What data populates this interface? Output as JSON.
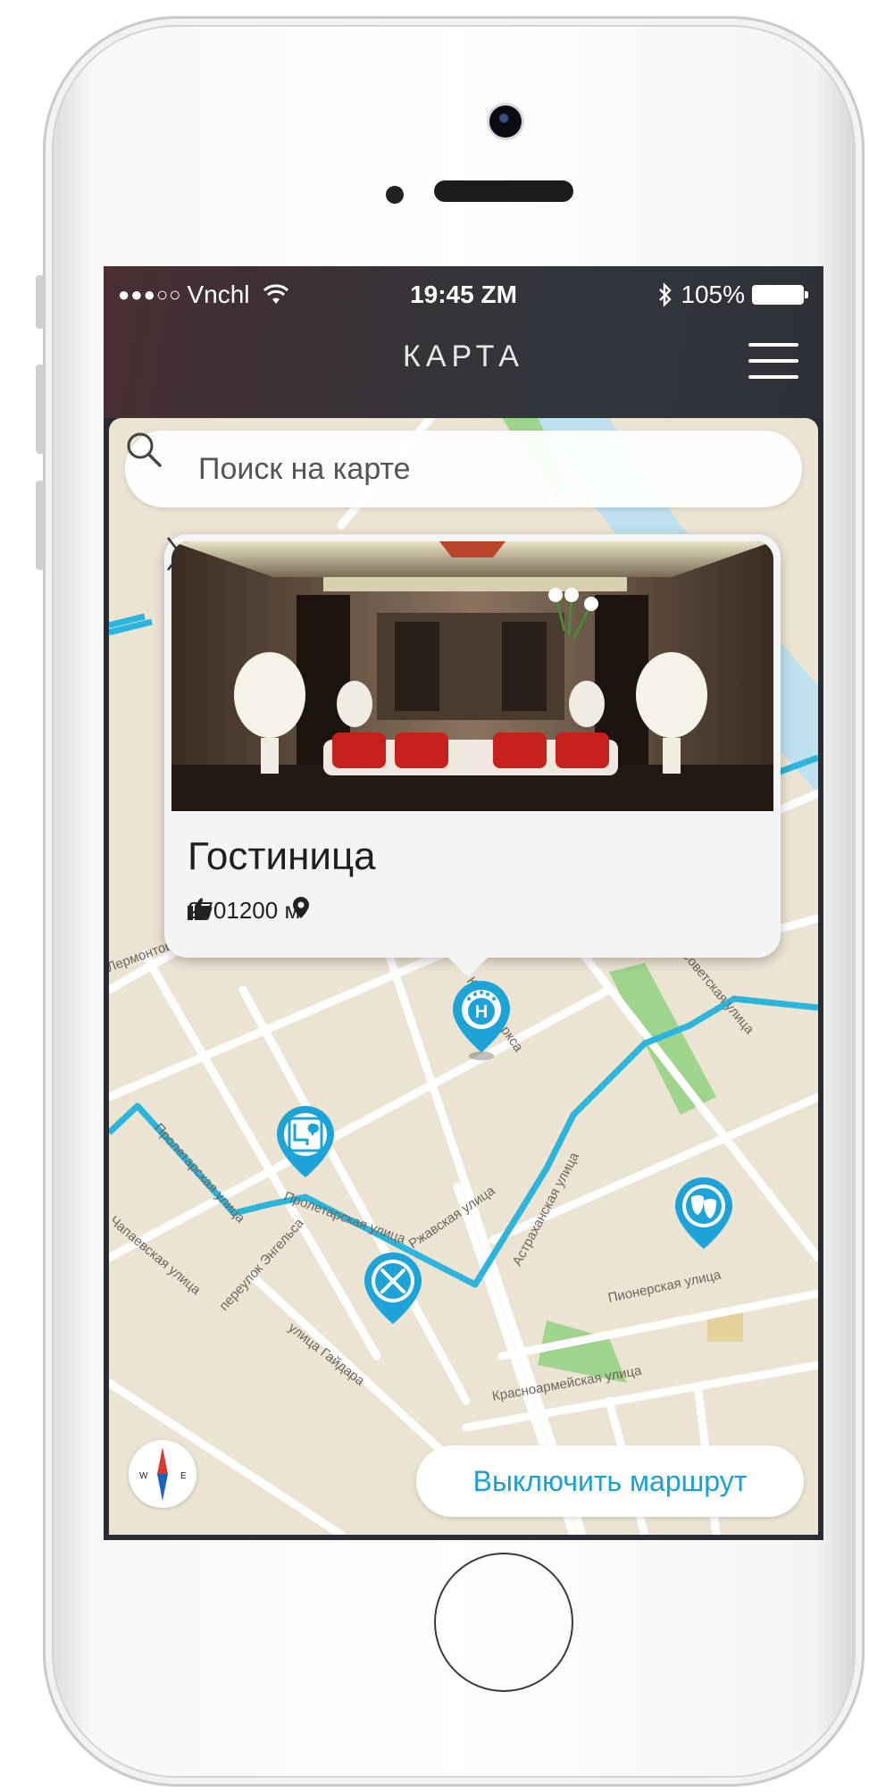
{
  "status_bar": {
    "carrier": "Vnchl",
    "signal_dots": "●●●○○",
    "time": "19:45 ZM",
    "battery": "105%"
  },
  "nav": {
    "title": "КАРТА"
  },
  "search": {
    "placeholder": "Поиск на карте"
  },
  "card": {
    "title": "Гостиница",
    "likes": "270",
    "distance": "1200 м"
  },
  "markers": {
    "hotel_letter": "H"
  },
  "streets": {
    "proletarskaya_1": "Пролетарская улица",
    "proletarskaya_2": "Пролетарская улица",
    "rzhavskaya": "Ржавская улица",
    "astrakhanskaya": "Астраханская улица",
    "pionerskaya": "Пионерская улица",
    "krasnoarmeyskaya": "Красноармейская улица",
    "engelsa": "переулок Энгельса",
    "gaydara": "улица Гайдара",
    "marksa": "Карла Маркса",
    "sovetskaya": "Советская улица",
    "lermontova": "Лермонтова",
    "chapaeva": "Чапаевская улица"
  },
  "compass": {
    "west": "W",
    "east": "E"
  },
  "route_button": {
    "label": "Выключить маршрут"
  },
  "colors": {
    "route": "#2bb5dc",
    "accent": "#1aa0d6",
    "marker": "#1ea3d8",
    "map_bg": "#ece4d3",
    "park": "#9fd48c"
  }
}
